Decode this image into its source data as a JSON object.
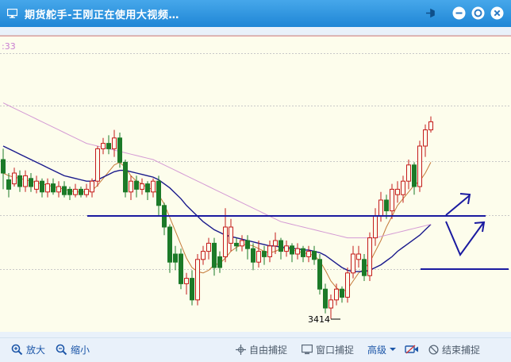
{
  "window": {
    "title": "期货舵手-王刚正在使用大视频…",
    "title_icon": "monitor-icon",
    "buttons": [
      "pin-icon",
      "minimize-icon",
      "settings-icon",
      "close-icon"
    ]
  },
  "chart": {
    "corner_label": ":33",
    "low_annotation": "3414",
    "colors": {
      "background": "#fdfdec",
      "up_candle": "#c41a1a",
      "down_candle": "#1c7a28",
      "ma_short": "#c47a3a",
      "ma_mid": "#1a1a8c",
      "ma_long": "#d49ad4",
      "drawn_lines": "#1a1aa0"
    }
  },
  "chart_data": {
    "type": "candlestick",
    "low_label": "3414",
    "candles": [
      [
        0,
        120,
        110,
        98,
        128
      ],
      [
        0,
        105,
        98,
        92,
        110
      ],
      [
        1,
        102,
        110,
        100,
        114
      ],
      [
        0,
        108,
        100,
        96,
        112
      ],
      [
        1,
        100,
        108,
        96,
        112
      ],
      [
        0,
        106,
        100,
        96,
        110
      ],
      [
        1,
        98,
        104,
        95,
        108
      ],
      [
        0,
        104,
        96,
        92,
        106
      ],
      [
        1,
        96,
        102,
        92,
        106
      ],
      [
        0,
        102,
        96,
        94,
        106
      ],
      [
        1,
        96,
        100,
        92,
        104
      ],
      [
        0,
        100,
        94,
        92,
        104
      ],
      [
        0,
        98,
        94,
        90,
        100
      ],
      [
        1,
        94,
        98,
        92,
        102
      ],
      [
        0,
        98,
        94,
        92,
        100
      ],
      [
        1,
        94,
        98,
        92,
        102
      ],
      [
        1,
        96,
        104,
        92,
        106
      ],
      [
        1,
        104,
        128,
        100,
        130
      ],
      [
        1,
        128,
        132,
        124,
        136
      ],
      [
        0,
        132,
        128,
        124,
        138
      ],
      [
        1,
        128,
        136,
        122,
        142
      ],
      [
        0,
        136,
        118,
        114,
        140
      ],
      [
        0,
        118,
        96,
        92,
        120
      ],
      [
        1,
        96,
        104,
        90,
        108
      ],
      [
        0,
        104,
        98,
        92,
        108
      ],
      [
        1,
        98,
        102,
        94,
        106
      ],
      [
        0,
        102,
        96,
        90,
        104
      ],
      [
        1,
        96,
        104,
        92,
        106
      ],
      [
        0,
        104,
        86,
        78,
        108
      ],
      [
        0,
        86,
        70,
        64,
        88
      ],
      [
        0,
        70,
        44,
        36,
        72
      ],
      [
        0,
        44,
        50,
        38,
        56
      ],
      [
        0,
        50,
        28,
        24,
        54
      ],
      [
        1,
        28,
        32,
        20,
        36
      ],
      [
        0,
        32,
        16,
        12,
        38
      ],
      [
        1,
        16,
        46,
        12,
        50
      ],
      [
        1,
        46,
        52,
        42,
        56
      ],
      [
        1,
        52,
        58,
        46,
        62
      ],
      [
        0,
        58,
        40,
        34,
        62
      ],
      [
        0,
        40,
        48,
        36,
        52
      ],
      [
        1,
        48,
        70,
        44,
        84
      ],
      [
        1,
        70,
        58,
        52,
        76
      ],
      [
        0,
        58,
        56,
        52,
        62
      ],
      [
        1,
        56,
        60,
        52,
        64
      ],
      [
        0,
        60,
        54,
        46,
        64
      ],
      [
        0,
        54,
        44,
        38,
        58
      ],
      [
        1,
        44,
        52,
        40,
        60
      ],
      [
        0,
        52,
        48,
        42,
        56
      ],
      [
        1,
        48,
        56,
        44,
        60
      ],
      [
        1,
        56,
        60,
        50,
        66
      ],
      [
        0,
        60,
        52,
        46,
        62
      ],
      [
        1,
        52,
        56,
        48,
        60
      ],
      [
        0,
        56,
        50,
        44,
        58
      ],
      [
        1,
        50,
        54,
        46,
        58
      ],
      [
        0,
        54,
        48,
        44,
        56
      ],
      [
        1,
        48,
        52,
        44,
        56
      ],
      [
        0,
        52,
        46,
        42,
        56
      ],
      [
        0,
        46,
        24,
        20,
        50
      ],
      [
        0,
        24,
        10,
        6,
        28
      ],
      [
        1,
        10,
        16,
        2,
        20
      ],
      [
        1,
        16,
        24,
        12,
        28
      ],
      [
        0,
        24,
        18,
        14,
        26
      ],
      [
        1,
        18,
        36,
        14,
        40
      ],
      [
        1,
        36,
        50,
        32,
        56
      ],
      [
        1,
        50,
        46,
        40,
        56
      ],
      [
        0,
        46,
        34,
        30,
        50
      ],
      [
        1,
        34,
        62,
        30,
        66
      ],
      [
        1,
        62,
        78,
        56,
        84
      ],
      [
        1,
        78,
        90,
        74,
        96
      ],
      [
        0,
        90,
        82,
        76,
        94
      ],
      [
        1,
        82,
        98,
        76,
        102
      ],
      [
        1,
        98,
        94,
        88,
        104
      ],
      [
        1,
        94,
        104,
        88,
        108
      ],
      [
        1,
        104,
        116,
        98,
        120
      ],
      [
        0,
        116,
        100,
        94,
        118
      ],
      [
        1,
        100,
        130,
        96,
        134
      ],
      [
        1,
        130,
        142,
        122,
        146
      ],
      [
        1,
        142,
        148,
        140,
        152
      ]
    ],
    "series": [
      {
        "values": [
          110,
          108,
          107,
          106,
          105,
          104,
          103,
          102,
          101,
          100,
          99,
          98,
          97,
          96,
          96,
          96,
          97,
          101,
          106,
          111,
          116,
          118,
          114,
          108,
          104,
          102,
          99,
          98,
          94,
          87,
          77,
          67,
          57,
          47,
          40,
          37,
          36,
          38,
          42,
          43,
          47,
          52,
          55,
          57,
          57,
          56,
          54,
          52,
          51,
          52,
          54,
          54,
          53,
          52,
          51,
          50,
          49,
          45,
          38,
          30,
          25,
          22,
          24,
          30,
          36,
          39,
          44,
          52,
          60,
          70,
          78,
          86,
          91,
          96,
          101,
          104,
          110,
          118
        ]
      },
      {
        "values": [
          130,
          128,
          126,
          124,
          122,
          120,
          118,
          116,
          114,
          112,
          110,
          108,
          107,
          106,
          105,
          104,
          104,
          105,
          107,
          109,
          111,
          112,
          112,
          111,
          110,
          109,
          108,
          107,
          105,
          102,
          99,
          95,
          91,
          86,
          82,
          78,
          74,
          71,
          68,
          66,
          64,
          63,
          62,
          61,
          60,
          59,
          58,
          57,
          56,
          56,
          55,
          55,
          54,
          54,
          53,
          53,
          52,
          51,
          49,
          46,
          43,
          40,
          38,
          37,
          37,
          37,
          38,
          40,
          42,
          45,
          48,
          52,
          55,
          58,
          61,
          64,
          68,
          72
        ]
      },
      {
        "values": [
          162,
          160,
          158,
          156,
          154,
          152,
          150,
          148,
          146,
          144,
          142,
          140,
          138,
          136,
          134,
          132,
          131,
          130,
          129,
          128,
          127,
          126,
          125,
          124,
          123,
          122,
          121,
          120,
          118,
          116,
          114,
          112,
          110,
          108,
          106,
          104,
          102,
          100,
          98,
          96,
          94,
          92,
          90,
          88,
          86,
          84,
          82,
          80,
          78,
          76,
          74,
          73,
          72,
          71,
          70,
          69,
          68,
          67,
          66,
          65,
          64,
          63,
          62,
          62,
          62,
          62,
          62,
          62,
          63,
          64,
          65,
          66,
          67,
          68,
          69,
          70,
          71,
          72
        ]
      }
    ]
  },
  "toolbar": {
    "zoom_in": "放大",
    "zoom_out": "缩小",
    "free_capture": "自由捕捉",
    "window_capture": "窗口捕捉",
    "advanced": "高级",
    "end_capture": "结束捕捉"
  }
}
